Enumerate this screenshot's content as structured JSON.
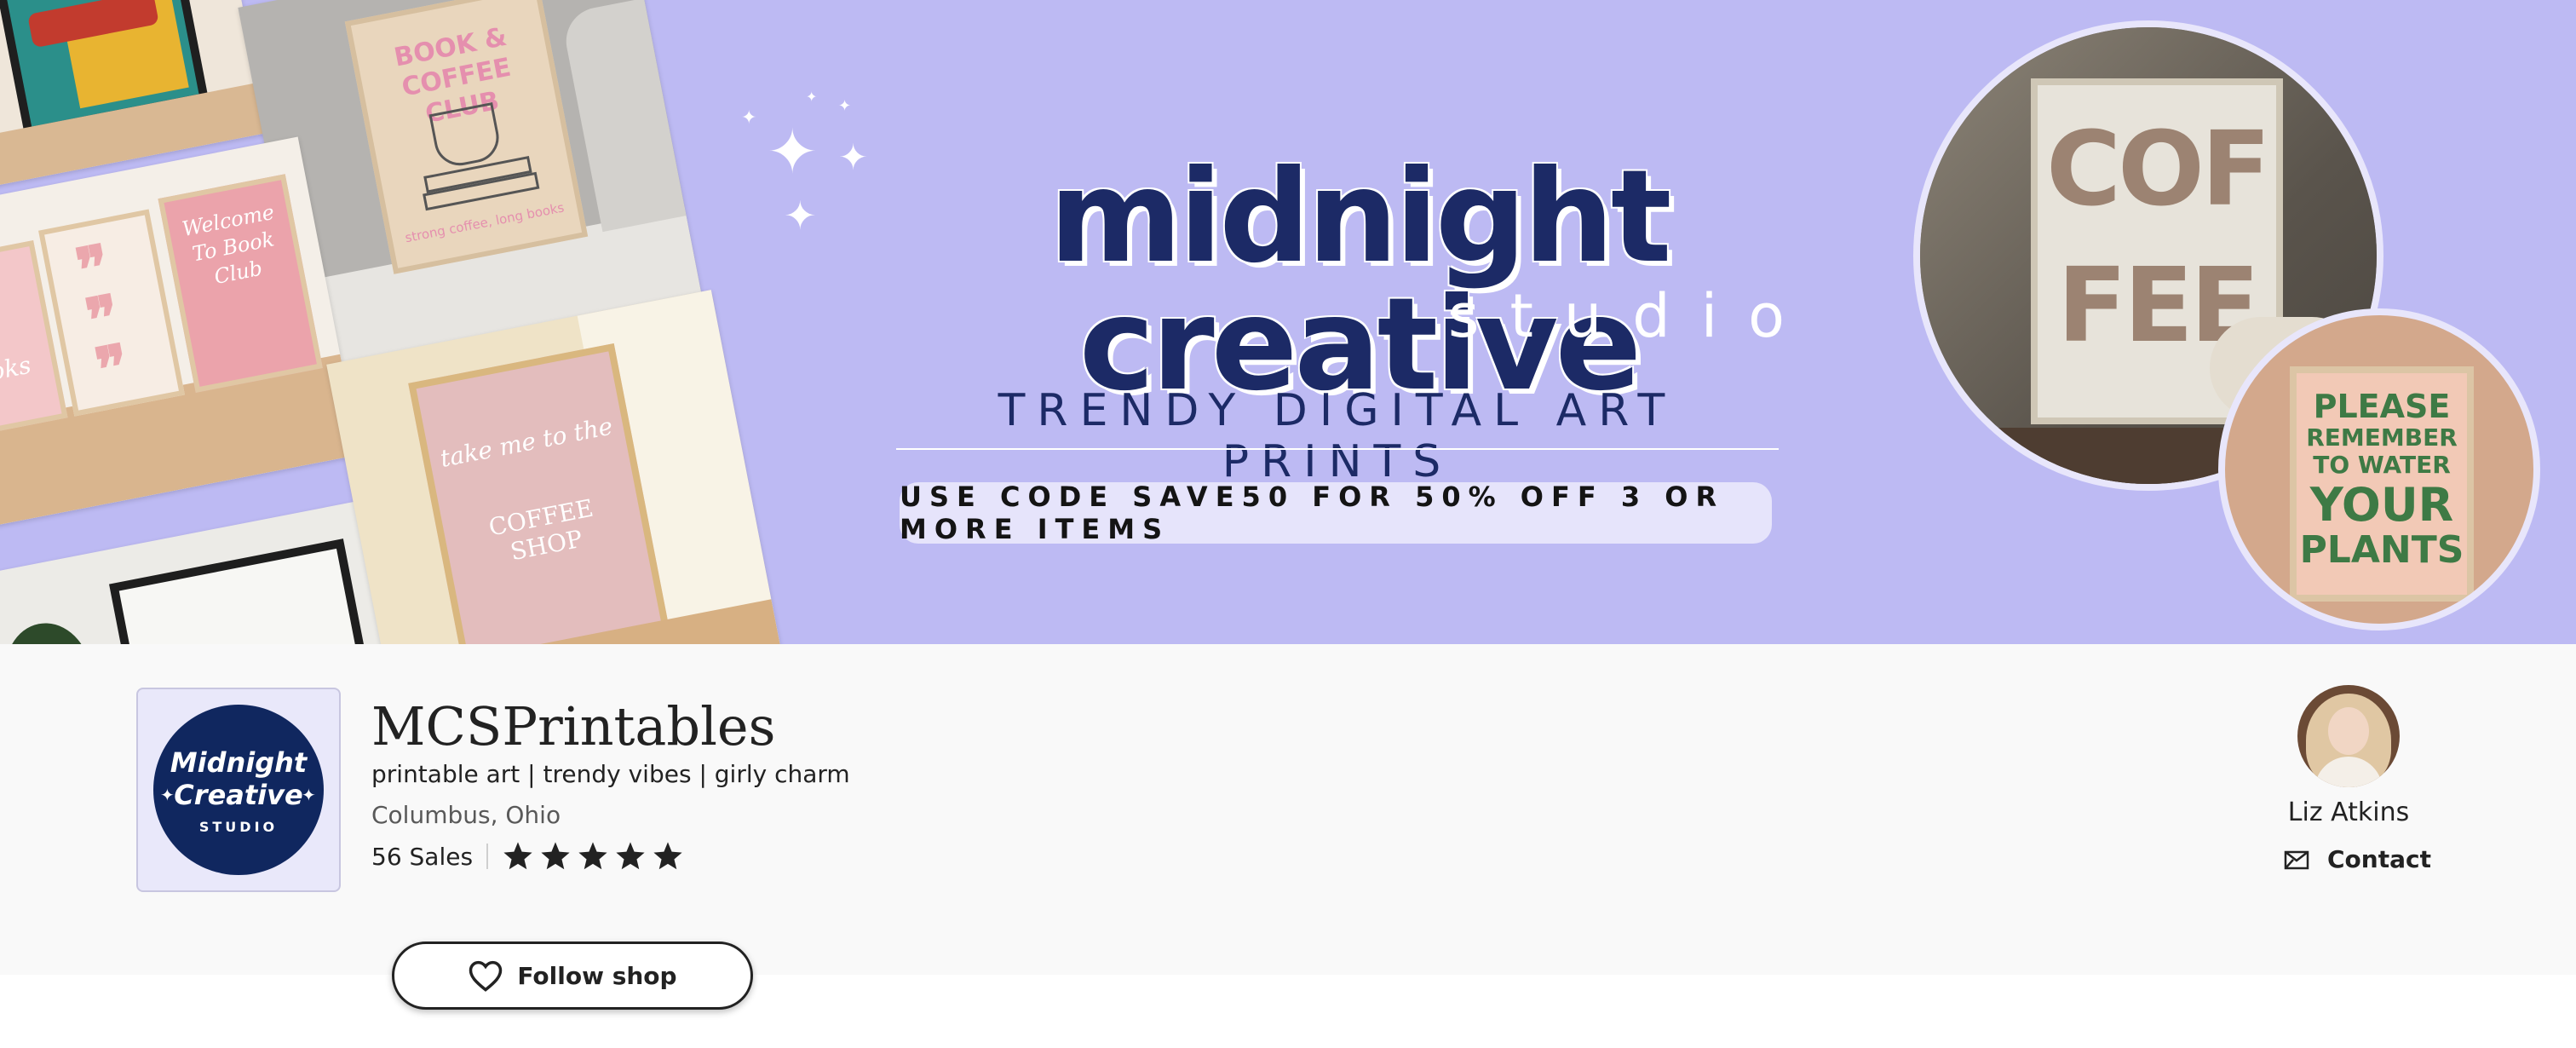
{
  "banner": {
    "headline": "midnight creative",
    "subheadline": "studio",
    "tagline": "TRENDY DIGITAL ART PRINTS",
    "promo": "USE CODE SAVE50 FOR 50% OFF 3 OR MORE ITEMS",
    "background_color": "#bdbaf3",
    "prints": {
      "book_club_title": "BOOK & COFFEE CLUB",
      "book_club_sub": "strong coffee, long books",
      "welcome": "Welcome To Book Club",
      "coffee_shop_1": "take me to the",
      "coffee_shop_2": "COFFEE SHOP",
      "coffee_poster_1": "COF",
      "coffee_poster_2": "FEE",
      "plants_1": "PLEASE",
      "plants_2": "REMEMBER",
      "plants_3": "TO WATER",
      "plants_4": "YOUR",
      "plants_5": "PLANTS",
      "books_partial": "ooks"
    }
  },
  "shop": {
    "logo_line1": "Midnight",
    "logo_line2": "Creative",
    "logo_line3": "STUDIO",
    "name": "MCSPrintables",
    "tagline": "printable art | trendy vibes | girly charm",
    "location": "Columbus, Ohio",
    "sales": "56 Sales",
    "rating": 5,
    "follow_label": "Follow shop"
  },
  "owner": {
    "name": "Liz Atkins",
    "contact_label": "Contact"
  },
  "icons": {
    "star": "star-icon",
    "heart": "heart-icon",
    "mail": "mail-icon"
  }
}
